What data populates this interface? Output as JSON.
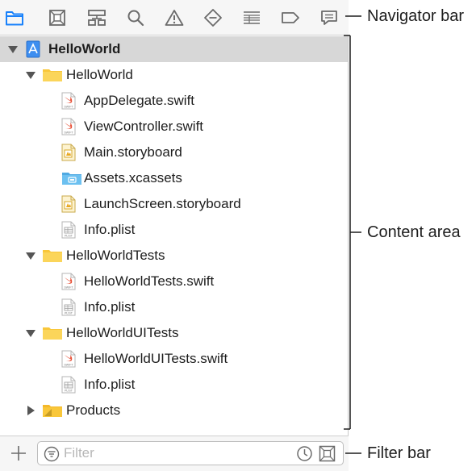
{
  "navigator": {
    "icons": [
      "folder-icon",
      "source-control-icon",
      "symbol-icon",
      "search-icon",
      "issue-icon",
      "test-icon",
      "debug-icon",
      "breakpoint-icon",
      "report-icon"
    ]
  },
  "tree": [
    {
      "label": "HelloWorld",
      "kind": "project",
      "depth": 0,
      "expanded": true,
      "selected": true
    },
    {
      "label": "HelloWorld",
      "kind": "folder",
      "depth": 1,
      "expanded": true
    },
    {
      "label": "AppDelegate.swift",
      "kind": "swift",
      "depth": 2
    },
    {
      "label": "ViewController.swift",
      "kind": "swift",
      "depth": 2
    },
    {
      "label": "Main.storyboard",
      "kind": "storyboard",
      "depth": 2
    },
    {
      "label": "Assets.xcassets",
      "kind": "assets",
      "depth": 2
    },
    {
      "label": "LaunchScreen.storyboard",
      "kind": "storyboard",
      "depth": 2
    },
    {
      "label": "Info.plist",
      "kind": "plist",
      "depth": 2
    },
    {
      "label": "HelloWorldTests",
      "kind": "folder",
      "depth": 1,
      "expanded": true
    },
    {
      "label": "HelloWorldTests.swift",
      "kind": "swift",
      "depth": 2
    },
    {
      "label": "Info.plist",
      "kind": "plist",
      "depth": 2
    },
    {
      "label": "HelloWorldUITests",
      "kind": "folder",
      "depth": 1,
      "expanded": true
    },
    {
      "label": "HelloWorldUITests.swift",
      "kind": "swift",
      "depth": 2
    },
    {
      "label": "Info.plist",
      "kind": "plist",
      "depth": 2
    },
    {
      "label": "Products",
      "kind": "products",
      "depth": 1,
      "expanded": false
    }
  ],
  "filter": {
    "placeholder": "Filter"
  },
  "callouts": {
    "navigator_bar": "Navigator bar",
    "content_area": "Content area",
    "filter_bar": "Filter bar"
  },
  "colors": {
    "accent": "#1a82fb",
    "icon_gray": "#6b6b6b",
    "selection": "#d7d7d7",
    "folder_yellow": "#f9c73a",
    "assets_blue": "#6cc0f0",
    "swift_orange": "#e8533a"
  }
}
